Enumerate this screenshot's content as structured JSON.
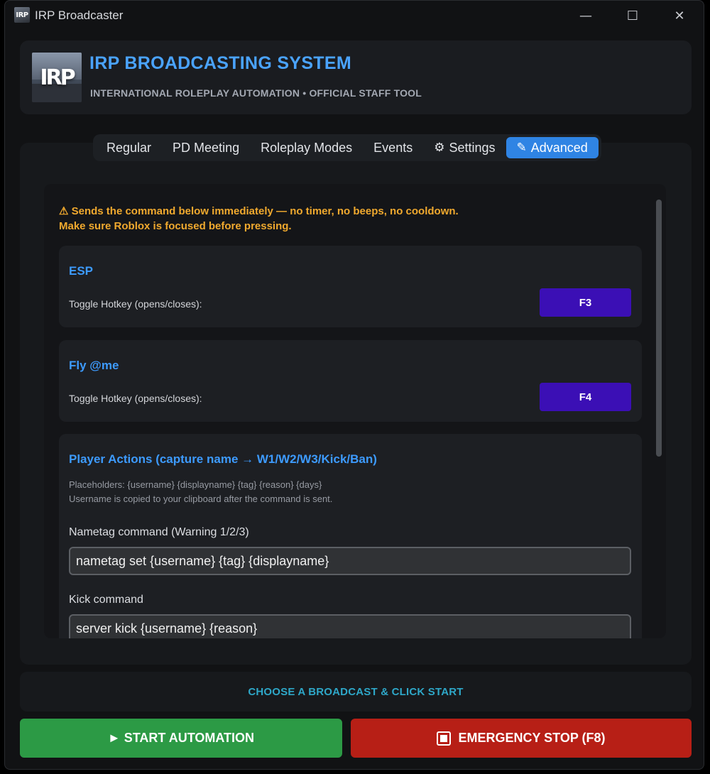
{
  "window": {
    "title": "IRP Broadcaster",
    "icon_text": "IRP",
    "controls": {
      "minimize": "—",
      "maximize": "☐",
      "close": "✕"
    }
  },
  "header": {
    "logo_text": "IRP",
    "title": "IRP BROADCASTING SYSTEM",
    "subtitle": "INTERNATIONAL ROLEPLAY AUTOMATION • OFFICIAL STAFF TOOL"
  },
  "tabs": [
    {
      "label": "Regular",
      "icon": ""
    },
    {
      "label": "PD Meeting",
      "icon": ""
    },
    {
      "label": "Roleplay Modes",
      "icon": ""
    },
    {
      "label": "Events",
      "icon": ""
    },
    {
      "label": "Settings",
      "icon": "⚙"
    },
    {
      "label": "Advanced",
      "icon": "✎",
      "active": true
    }
  ],
  "warning": {
    "line1": "⚠ Sends the command below immediately — no timer, no beeps, no cooldown.",
    "line2": "Make sure Roblox is focused before pressing."
  },
  "esp": {
    "title": "ESP",
    "hotkey_label": "Toggle Hotkey (opens/closes):",
    "hotkey": "F3"
  },
  "fly": {
    "title": "Fly @me",
    "hotkey_label": "Toggle Hotkey (opens/closes):",
    "hotkey": "F4"
  },
  "player_actions": {
    "title": "Player Actions (capture name → W1/W2/W3/Kick/Ban)",
    "placeholders": "Placeholders: {username} {displayname} {tag} {reason} {days}",
    "clipboard_note": "Username is copied to your clipboard after the command is sent.",
    "nametag_label": "Nametag command (Warning 1/2/3)",
    "nametag_value": "nametag set {username} {tag} {displayname}",
    "kick_label": "Kick command",
    "kick_value": "server kick {username} {reason}"
  },
  "status": "CHOOSE A BROADCAST & CLICK START",
  "buttons": {
    "start": "► START AUTOMATION",
    "stop": "EMERGENCY STOP (F8)"
  },
  "colors": {
    "accent": "#2f84e4",
    "title_blue": "#4aa3ff",
    "warning": "#f0a92e",
    "hotkey": "#3b0fb5",
    "start": "#2c9a45",
    "stop": "#b71f16",
    "status": "#2ea7c8"
  }
}
